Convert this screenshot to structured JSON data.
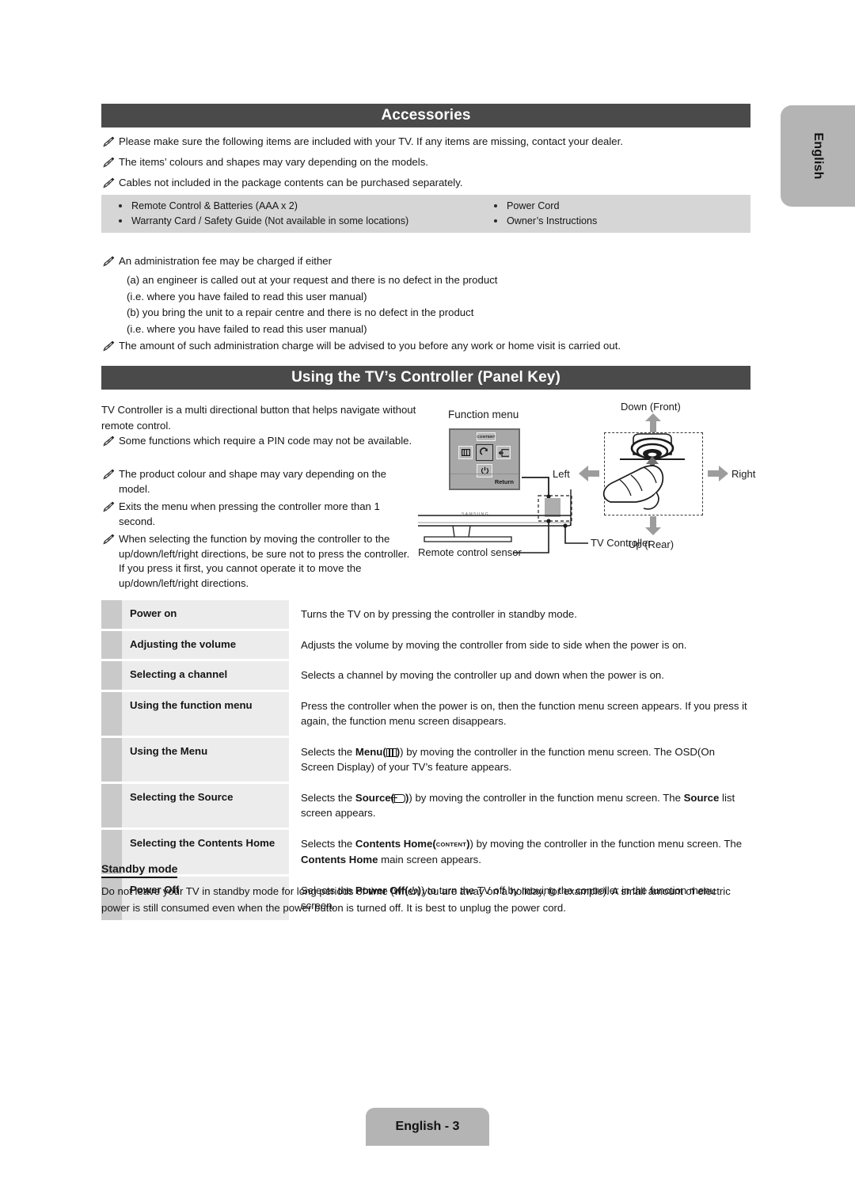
{
  "side_tab": {
    "label": "English"
  },
  "sections": {
    "accessories": {
      "title": "Accessories"
    },
    "controller": {
      "title": "Using the TV’s Controller (Panel Key)"
    }
  },
  "accessories": {
    "notes": [
      "Please make sure the following items are included with your TV. If any items are missing, contact your dealer.",
      "The items’ colours and shapes may vary depending on the models.",
      "Cables not included in the package contents can be purchased separately."
    ],
    "items_left": [
      "Remote Control & Batteries (AAA x 2)",
      "Warranty Card / Safety Guide (Not available in some locations)"
    ],
    "items_right": [
      "Power Cord",
      "Owner’s Instructions"
    ],
    "fee_note": "An administration fee may be charged if either",
    "fee_lines": [
      "(a) an engineer is called out at your request and there is no defect in the product",
      "(i.e. where you have failed to read this user manual)",
      "(b) you bring the unit to a repair centre and there is no defect in the product",
      "(i.e. where you have failed to read this user manual)"
    ],
    "charge_note": "The amount of such administration charge will be advised to you before any work or home visit is carried out."
  },
  "controller": {
    "intro": "TV Controller is a multi directional button that helps navigate without remote control.",
    "notes": [
      "Some functions which require a PIN code may not be available.",
      "The product colour and shape may vary depending on the model.",
      "Exits the menu when pressing the controller more than 1 second.",
      "When selecting the function by moving the controller to the up/down/left/right directions, be sure not to press the controller. If you press it first, you cannot operate it to move the up/down/left/right directions."
    ],
    "diagram": {
      "function_menu_label": "Function menu",
      "return_label": "Return",
      "content_key": "CONTENT",
      "remote_sensor_label": "Remote control sensor",
      "tv_controller_label": "TV Controller",
      "brand": "SAMSUNG",
      "dir_up": "Down (Front)",
      "dir_down": "Up (Rear)",
      "dir_left": "Left",
      "dir_right": "Right"
    }
  },
  "function_table": {
    "rows": [
      {
        "label": "Power on",
        "desc_pre": "Turns the TV on by pressing the controller in standby mode.",
        "icon": "",
        "desc_post": ""
      },
      {
        "label": "Adjusting the volume",
        "desc_pre": "Adjusts the volume by moving the controller from side to side when the power is on.",
        "icon": "",
        "desc_post": ""
      },
      {
        "label": "Selecting a channel",
        "desc_pre": "Selects a channel by moving the controller up and down when the power is on.",
        "icon": "",
        "desc_post": ""
      },
      {
        "label": "Using the function menu",
        "desc_pre": "Press the controller when the power is on, then the function menu screen appears. If you press it again, the function menu screen disappears.",
        "icon": "",
        "desc_post": ""
      },
      {
        "label": "Using the Menu",
        "desc_pre": "Selects the ",
        "strong1": "Menu(",
        "icon": "menu-icon",
        "desc_post": ") by moving the controller in the function menu screen. The OSD(On Screen Display) of your TV’s feature appears."
      },
      {
        "label": "Selecting the Source",
        "desc_pre": "Selects the ",
        "strong1": "Source(",
        "icon": "source-icon",
        "desc_post": ") by moving the controller in the function menu screen. The ",
        "strong2": "Source",
        "desc_tail": " list screen appears."
      },
      {
        "label": "Selecting the Contents Home",
        "desc_pre": "Selects the ",
        "strong1": "Contents Home(",
        "icon": "CONTENT",
        "desc_post": ") by moving the controller in the function menu screen. The ",
        "strong2": "Contents Home",
        "desc_tail": " main screen appears."
      },
      {
        "label": "Power Off",
        "desc_pre": "Selects the ",
        "strong1": "Power Off(",
        "icon": "power-icon",
        "desc_post": ") to turn the TV off by moving the controller in the function menu screen."
      }
    ]
  },
  "standby": {
    "heading": "Standby mode",
    "body": "Do not leave your TV in standby mode for long periods of time (when you are away on a holiday, for example). A small amount of electric power is still consumed even when the power button is turned off. It is best to unplug the power cord."
  },
  "footer": {
    "page_label": "English - 3"
  }
}
